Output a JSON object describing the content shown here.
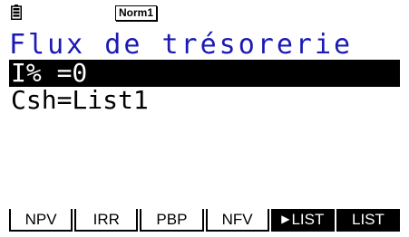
{
  "status_bar": {
    "battery_icon": "battery-icon",
    "mode": "Norm1"
  },
  "title": "Flux de trésorerie",
  "rows": [
    {
      "text": "I% =0",
      "highlighted": true
    },
    {
      "text": "Csh=List1",
      "highlighted": false
    }
  ],
  "function_keys": [
    {
      "label": "NPV"
    },
    {
      "label": "IRR"
    },
    {
      "label": "PBP"
    },
    {
      "label": "NFV"
    },
    {
      "label": "LIST",
      "icon": "triangle-right-icon"
    },
    {
      "label": "LIST"
    }
  ],
  "colors": {
    "title": "#1a1ab4",
    "background": "#ffffff",
    "foreground": "#000000"
  }
}
